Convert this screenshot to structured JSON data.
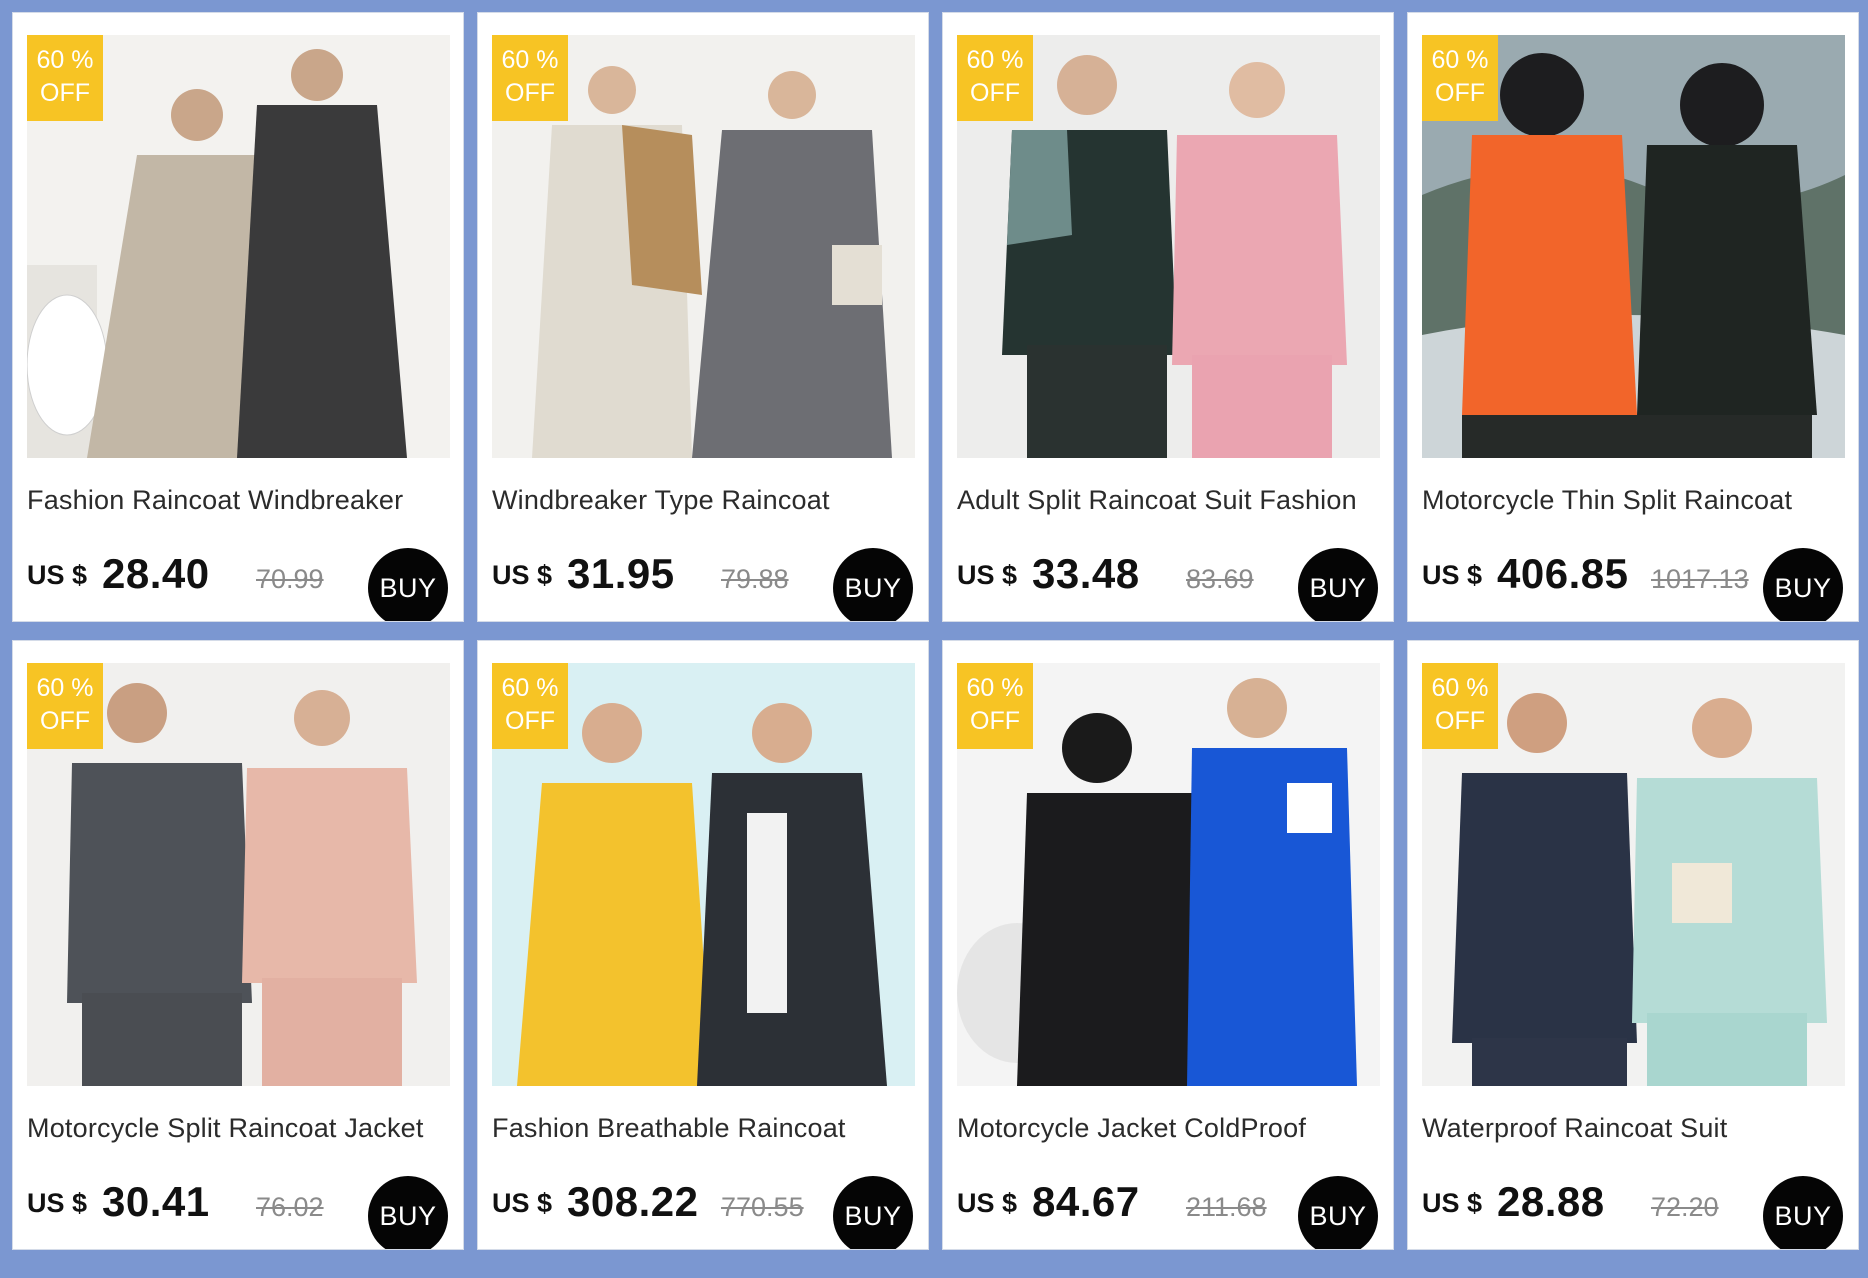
{
  "badge": {
    "line1": "60 %",
    "line2": "OFF"
  },
  "buy_label": "BUY",
  "currency": "US $",
  "products": [
    {
      "title": "Fashion Raincoat Windbreaker",
      "price": "28.40",
      "old_price": "70.99"
    },
    {
      "title": "Windbreaker Type Raincoat",
      "price": "31.95",
      "old_price": "79.88"
    },
    {
      "title": "Adult Split Raincoat Suit Fashion",
      "price": "33.48",
      "old_price": "83.69"
    },
    {
      "title": "Motorcycle Thin Split Raincoat",
      "price": "406.85",
      "old_price": "1017.13"
    },
    {
      "title": "Motorcycle Split Raincoat Jacket",
      "price": "30.41",
      "old_price": "76.02"
    },
    {
      "title": "Fashion Breathable Raincoat",
      "price": "308.22",
      "old_price": "770.55"
    },
    {
      "title": "Motorcycle Jacket ColdProof",
      "price": "84.67",
      "old_price": "211.68"
    },
    {
      "title": "Waterproof Raincoat Suit",
      "price": "28.88",
      "old_price": "72.20"
    }
  ],
  "colors": {
    "page_background": "#7b97d1",
    "badge": "#f7c424",
    "buy_button": "#050505"
  }
}
